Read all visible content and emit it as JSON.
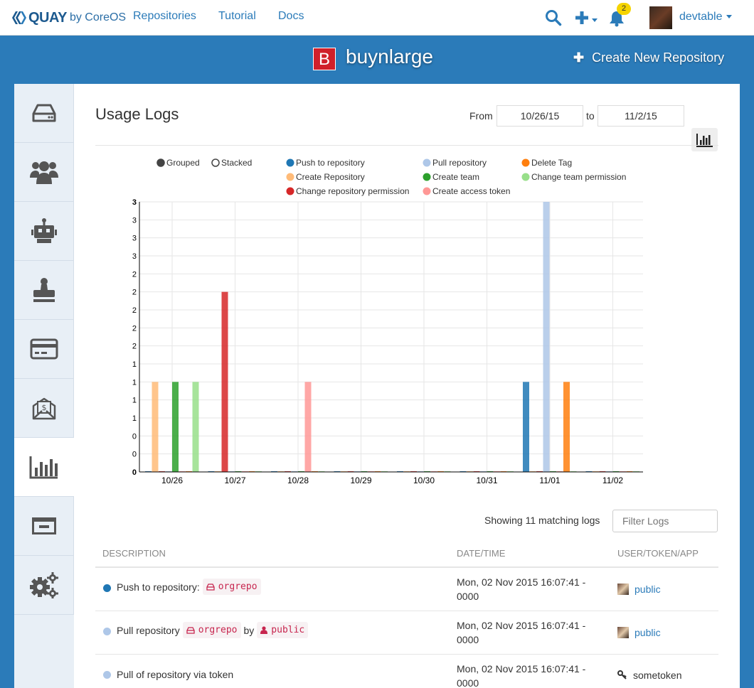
{
  "nav": {
    "brand": "QUAY",
    "brand_sub": "by CoreOS",
    "links": [
      "Repositories",
      "Tutorial",
      "Docs"
    ],
    "notifications": "2",
    "username": "devtable"
  },
  "org": {
    "badge_letter": "B",
    "badge_color": "#d0202a",
    "name": "buynlarge",
    "create_repo": "Create New Repository"
  },
  "sidebar": {
    "items": [
      {
        "icon": "hdd-icon",
        "active": false
      },
      {
        "icon": "users-icon",
        "active": false
      },
      {
        "icon": "robot-icon",
        "active": false
      },
      {
        "icon": "user-stamp-icon",
        "active": false
      },
      {
        "icon": "credit-card-icon",
        "active": false
      },
      {
        "icon": "invoice-envelope-icon",
        "active": false
      },
      {
        "icon": "bar-chart-icon",
        "active": true
      },
      {
        "icon": "application-window-icon",
        "active": false
      },
      {
        "icon": "gears-icon",
        "active": false
      }
    ]
  },
  "logs": {
    "title": "Usage Logs",
    "from_label": "From",
    "from_date": "10/26/15",
    "to_label": "to",
    "to_date": "11/2/15",
    "showing": "Showing 11 matching logs",
    "filter_placeholder": "Filter Logs",
    "columns": [
      "DESCRIPTION",
      "DATE/TIME",
      "USER/TOKEN/APP"
    ],
    "rows": [
      {
        "color": "#1f77b4",
        "text": "Push to repository:",
        "repo": "orgrepo",
        "by": "",
        "by_user": "",
        "date": "Mon, 02 Nov 2015 16:07:41 - 0000",
        "user": "public",
        "user_icon": "avatar"
      },
      {
        "color": "#aec7e8",
        "text": "Pull repository",
        "repo": "orgrepo",
        "by": "by",
        "by_user": "public",
        "date": "Mon, 02 Nov 2015 16:07:41 - 0000",
        "user": "public",
        "user_icon": "avatar"
      },
      {
        "color": "#aec7e8",
        "text": "Pull of repository via token",
        "repo": "",
        "by": "",
        "by_user": "",
        "date": "Mon, 02 Nov 2015 16:07:41 - 0000",
        "user": "sometoken",
        "user_icon": "key-icon"
      }
    ]
  },
  "chart_data": {
    "type": "bar",
    "mode_options": [
      {
        "label": "Grouped",
        "selected": true
      },
      {
        "label": "Stacked",
        "selected": false
      }
    ],
    "legend_columns": [
      [
        {
          "name": "Push to repository",
          "color": "#1f77b4"
        },
        {
          "name": "Create Repository",
          "color": "#ffbb78"
        },
        {
          "name": "Change repository permission",
          "color": "#d62728"
        }
      ],
      [
        {
          "name": "Pull repository",
          "color": "#aec7e8"
        },
        {
          "name": "Create team",
          "color": "#2ca02c"
        },
        {
          "name": "Create access token",
          "color": "#ff9896"
        }
      ],
      [
        {
          "name": "Delete Tag",
          "color": "#ff7f0e"
        },
        {
          "name": "Change team permission",
          "color": "#98df8a"
        }
      ]
    ],
    "categories": [
      "10/26",
      "10/27",
      "10/28",
      "10/29",
      "10/30",
      "10/31",
      "11/01",
      "11/02"
    ],
    "series": [
      {
        "name": "Push to repository",
        "color": "#1f77b4",
        "values": [
          0,
          0,
          0,
          0,
          0,
          0,
          1,
          0
        ]
      },
      {
        "name": "Create Repository",
        "color": "#ffbb78",
        "values": [
          1,
          0,
          0,
          0,
          0,
          0,
          0,
          0
        ]
      },
      {
        "name": "Change repository permission",
        "color": "#d62728",
        "values": [
          0,
          2,
          0,
          0,
          0,
          0,
          0,
          0
        ]
      },
      {
        "name": "Pull repository",
        "color": "#aec7e8",
        "values": [
          0,
          0,
          0,
          0,
          0,
          0,
          3,
          0
        ]
      },
      {
        "name": "Create team",
        "color": "#2ca02c",
        "values": [
          1,
          0,
          0,
          0,
          0,
          0,
          0,
          0
        ]
      },
      {
        "name": "Create access token",
        "color": "#ff9896",
        "values": [
          0,
          0,
          1,
          0,
          0,
          0,
          0,
          0
        ]
      },
      {
        "name": "Delete Tag",
        "color": "#ff7f0e",
        "values": [
          0,
          0,
          0,
          0,
          0,
          0,
          1,
          0
        ]
      },
      {
        "name": "Change team permission",
        "color": "#98df8a",
        "values": [
          1,
          0,
          0,
          0,
          0,
          0,
          0,
          0
        ]
      }
    ],
    "y_ticks": [
      0,
      0.2,
      0.4,
      0.6,
      0.8,
      1,
      1.2,
      1.4,
      1.6,
      1.8,
      2,
      2.2,
      2.4,
      2.6,
      2.8,
      3
    ],
    "y_tick_labels": [
      "0",
      "0",
      "0",
      "1",
      "1",
      "1",
      "1",
      "2",
      "2",
      "2",
      "2",
      "2",
      "3",
      "3",
      "3",
      "3"
    ],
    "ylim": [
      0,
      3
    ],
    "grid": true
  }
}
